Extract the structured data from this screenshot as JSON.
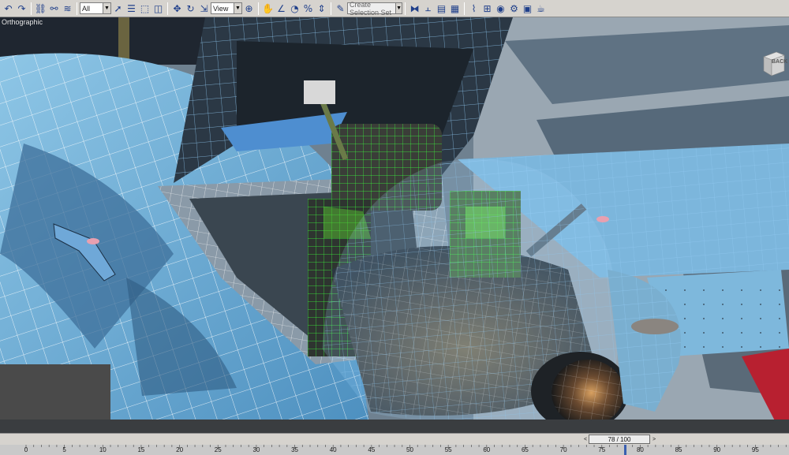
{
  "toolbar": {
    "selection_filter": "All",
    "reference_coord": "View",
    "named_selection_placeholder": "Create Selection Set",
    "buttons": [
      {
        "name": "undo-icon",
        "glyph": "↶"
      },
      {
        "name": "redo-icon",
        "glyph": "↷"
      },
      {
        "name": "select-and-link-icon",
        "glyph": "⛓"
      },
      {
        "name": "unlink-selection-icon",
        "glyph": "⚯"
      },
      {
        "name": "bind-to-space-warp-icon",
        "glyph": "≋"
      },
      {
        "name": "select-object-icon",
        "glyph": "➚"
      },
      {
        "name": "select-by-name-icon",
        "glyph": "☰"
      },
      {
        "name": "rectangular-selection-icon",
        "glyph": "⬚"
      },
      {
        "name": "window-crossing-icon",
        "glyph": "◫"
      },
      {
        "name": "select-and-move-icon",
        "glyph": "✥"
      },
      {
        "name": "select-and-rotate-icon",
        "glyph": "↻"
      },
      {
        "name": "select-and-scale-icon",
        "glyph": "⇲"
      },
      {
        "name": "use-pivot-center-icon",
        "glyph": "⊕"
      },
      {
        "name": "select-and-manipulate-icon",
        "glyph": "✋"
      },
      {
        "name": "snaps-toggle-icon",
        "glyph": "∠"
      },
      {
        "name": "angle-snap-icon",
        "glyph": "◔"
      },
      {
        "name": "percent-snap-icon",
        "glyph": "%"
      },
      {
        "name": "spinner-snap-icon",
        "glyph": "⇕"
      },
      {
        "name": "edit-named-selection-icon",
        "glyph": "✎"
      },
      {
        "name": "mirror-icon",
        "glyph": "⧓"
      },
      {
        "name": "align-icon",
        "glyph": "⫠"
      },
      {
        "name": "layer-manager-icon",
        "glyph": "▤"
      },
      {
        "name": "graphite-tools-icon",
        "glyph": "▦"
      },
      {
        "name": "curve-editor-icon",
        "glyph": "⌇"
      },
      {
        "name": "schematic-view-icon",
        "glyph": "⊞"
      },
      {
        "name": "material-editor-icon",
        "glyph": "◉"
      },
      {
        "name": "render-setup-icon",
        "glyph": "⚙"
      },
      {
        "name": "rendered-frame-window-icon",
        "glyph": "▣"
      },
      {
        "name": "render-production-icon",
        "glyph": "☕"
      }
    ]
  },
  "viewport": {
    "label": "Orthographic",
    "viewcube_label": "BACK"
  },
  "timeline": {
    "slider_label": "78 / 100",
    "prev_glyph": "<",
    "next_glyph": ">",
    "current_frame": 78,
    "total_frames": 100,
    "tick_labels": [
      "0",
      "5",
      "10",
      "15",
      "20",
      "25",
      "30",
      "35",
      "40",
      "45",
      "50",
      "55",
      "60",
      "65",
      "70",
      "75",
      "80",
      "85",
      "90",
      "95"
    ]
  },
  "colors": {
    "selected_wire": "#3cff3c",
    "mesh_wire": "#ffffff",
    "canopy_wire": "#9fd8ff",
    "hull_blue": "#6aaed8"
  }
}
